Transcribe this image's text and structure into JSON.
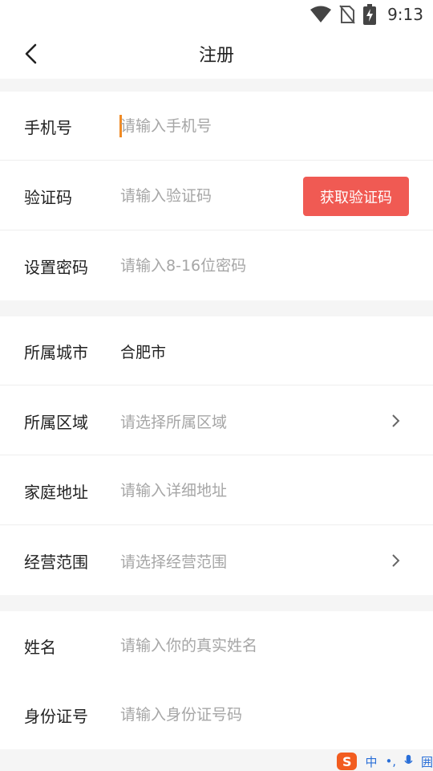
{
  "status_bar": {
    "time": "9:13"
  },
  "nav": {
    "title": "注册"
  },
  "form": {
    "phone": {
      "label": "手机号",
      "placeholder": "请输入手机号"
    },
    "code": {
      "label": "验证码",
      "placeholder": "请输入验证码",
      "button": "获取验证码"
    },
    "password": {
      "label": "设置密码",
      "placeholder": "请输入8-16位密码"
    },
    "city": {
      "label": "所属城市",
      "value": "合肥市"
    },
    "region": {
      "label": "所属区域",
      "placeholder": "请选择所属区域"
    },
    "address": {
      "label": "家庭地址",
      "placeholder": "请输入详细地址"
    },
    "business_scope": {
      "label": "经营范围",
      "placeholder": "请选择经营范围"
    },
    "name": {
      "label": "姓名",
      "placeholder": "请输入你的真实姓名"
    },
    "id_number": {
      "label": "身份证号",
      "placeholder": "请输入身份证号码"
    }
  },
  "ime": {
    "logo": "S",
    "mode": "中",
    "punct": "•,",
    "keyboard": "囲"
  },
  "colors": {
    "accent": "#f05a53",
    "caret": "#f08a24",
    "placeholder": "#a6a6a6",
    "section_bg": "#f5f5f5"
  }
}
